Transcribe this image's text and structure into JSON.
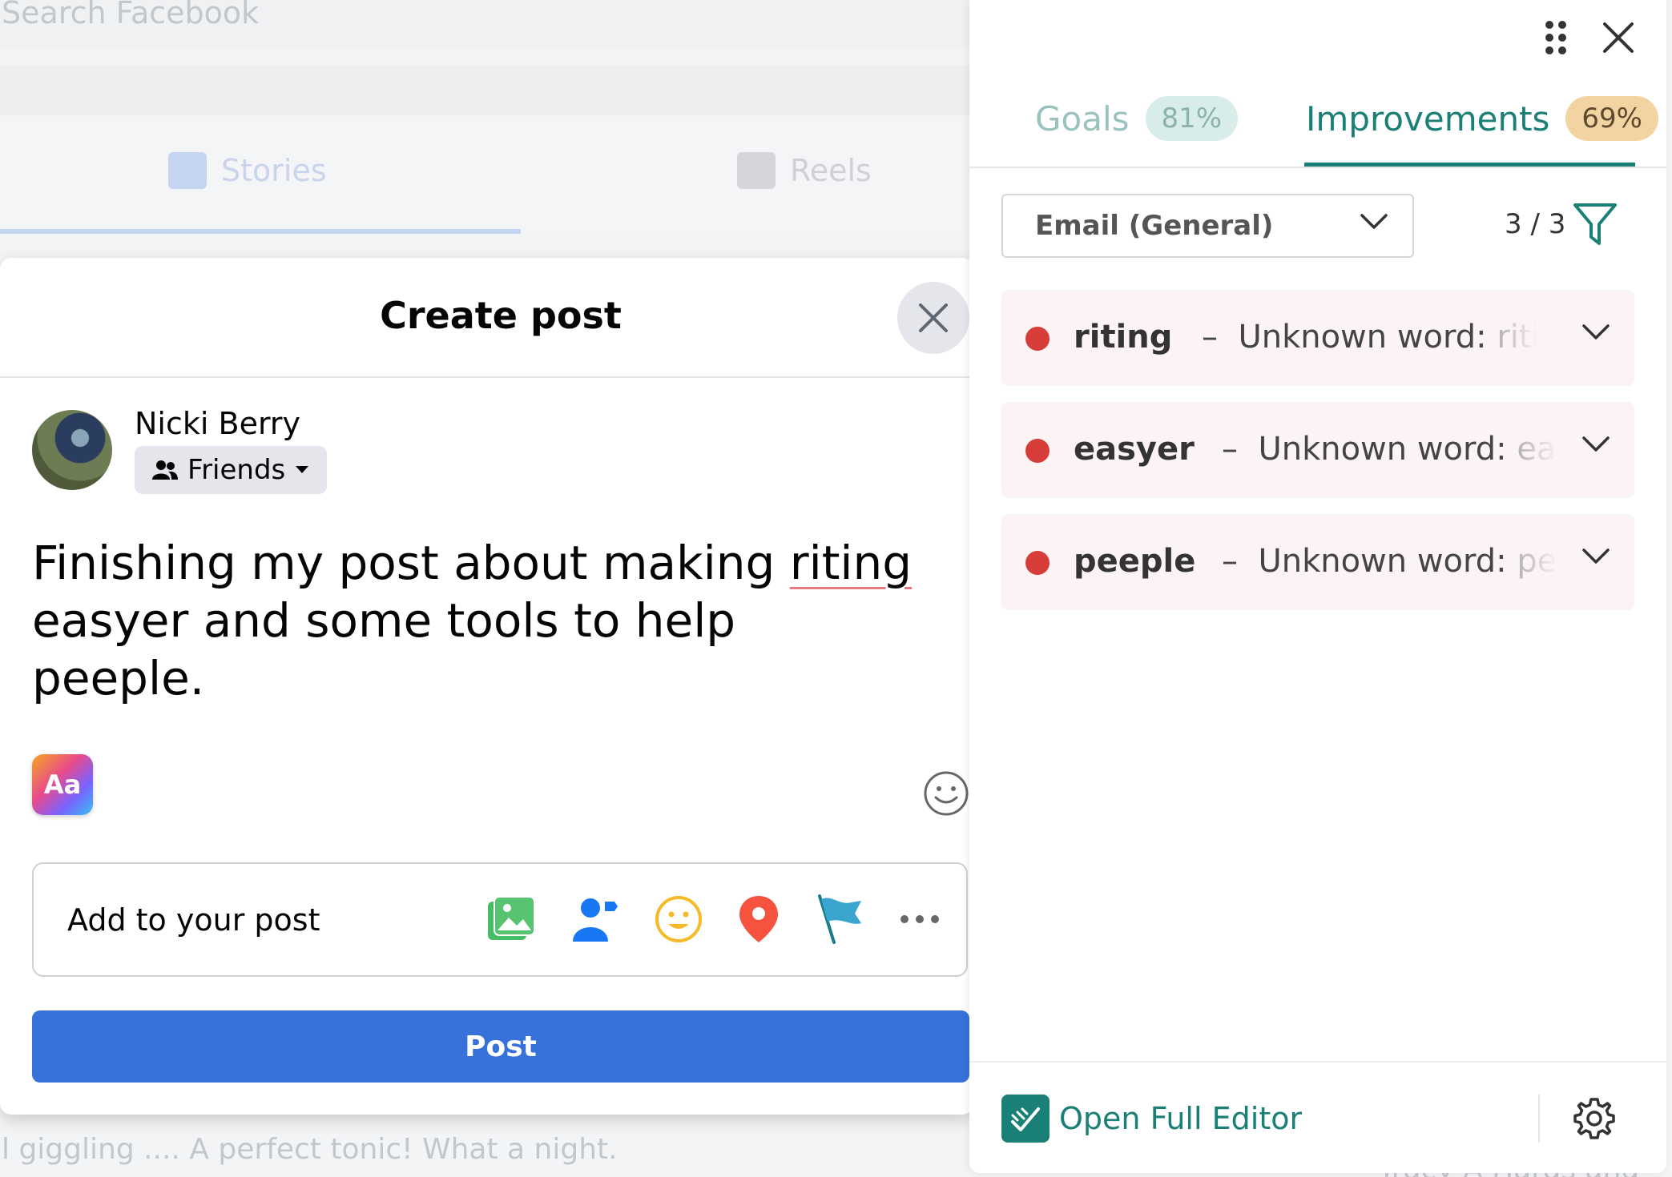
{
  "background": {
    "search_placeholder": "Search Facebook",
    "tab_stories": "Stories",
    "tab_reels": "Reels",
    "feed_snippet": "l giggling .... A perfect tonic! What a night.",
    "feed_snippet_right": "Tracy A Hards and Eli"
  },
  "dialog": {
    "title": "Create post",
    "user_name": "Nicki Berry",
    "audience": "Friends",
    "post_text_1": "Finishing my post about making ",
    "post_text_word": "riting",
    "post_text_2": "easyer and some tools to help peeple.",
    "aa_label": "Aa",
    "add_to_post": "Add to your post",
    "post_button": "Post"
  },
  "panel": {
    "tabs": [
      {
        "label": "Goals",
        "badge": "81%"
      },
      {
        "label": "Improvements",
        "badge": "69%"
      }
    ],
    "dropdown_value": "Email (General)",
    "count": "3 / 3",
    "issues": [
      {
        "word": "riting",
        "sep": "–",
        "desc": "Unknown word:",
        "desc_word": "riting"
      },
      {
        "word": "easyer",
        "sep": "–",
        "desc": "Unknown word:",
        "desc_word": "easyer"
      },
      {
        "word": "peeple",
        "sep": "–",
        "desc": "Unknown word:",
        "desc_word": "peeple"
      }
    ],
    "open_editor": "Open Full Editor"
  },
  "colors": {
    "accent": "#1a8076",
    "fb_blue": "#3672d9",
    "error": "#d63d39"
  }
}
